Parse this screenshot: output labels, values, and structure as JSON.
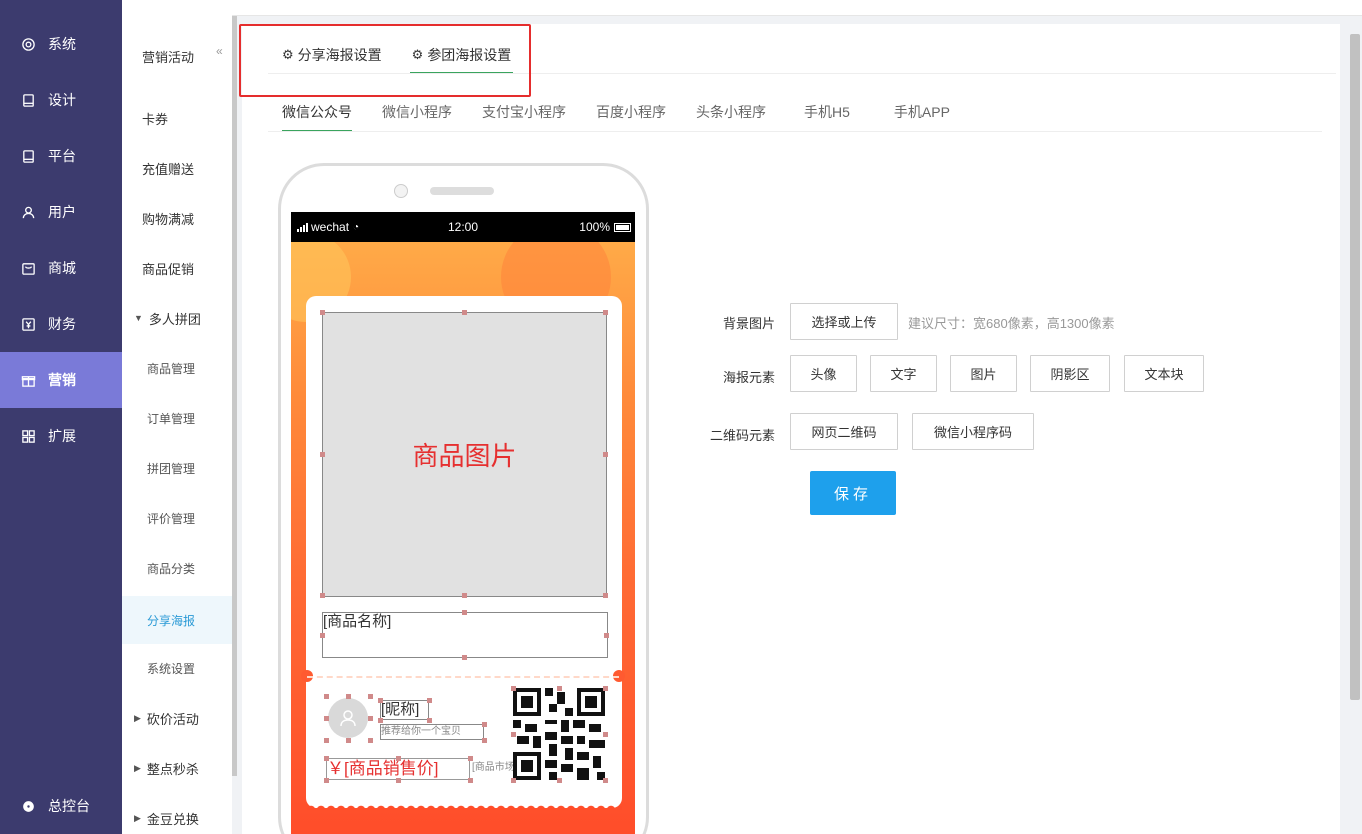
{
  "nav": {
    "items": [
      {
        "label": "系统",
        "icon": "gear-icon"
      },
      {
        "label": "设计",
        "icon": "tablet-icon"
      },
      {
        "label": "平台",
        "icon": "tablet-icon"
      },
      {
        "label": "用户",
        "icon": "user-icon"
      },
      {
        "label": "商城",
        "icon": "shop-icon"
      },
      {
        "label": "财务",
        "icon": "finance-icon"
      },
      {
        "label": "营销",
        "icon": "gift-icon",
        "active": true
      },
      {
        "label": "扩展",
        "icon": "grid-icon"
      }
    ],
    "bottom": {
      "label": "总控台",
      "icon": "gear-icon"
    }
  },
  "subnav": {
    "items": [
      {
        "label": "营销活动"
      },
      {
        "label": "卡券"
      },
      {
        "label": "充值赠送"
      },
      {
        "label": "购物满减"
      },
      {
        "label": "商品促销"
      },
      {
        "label": "多人拼团",
        "expanded": true
      },
      {
        "label": "商品管理"
      },
      {
        "label": "订单管理"
      },
      {
        "label": "拼团管理"
      },
      {
        "label": "评价管理"
      },
      {
        "label": "商品分类"
      },
      {
        "label": "分享海报",
        "active": true
      },
      {
        "label": "系统设置"
      },
      {
        "label": "砍价活动"
      },
      {
        "label": "整点秒杀"
      },
      {
        "label": "金豆兑换"
      }
    ],
    "collapse": "«"
  },
  "poster_tabs": [
    {
      "label": "分享海报设置"
    },
    {
      "label": "参团海报设置",
      "active": true
    }
  ],
  "platform_tabs": [
    {
      "label": "微信公众号",
      "active": true
    },
    {
      "label": "微信小程序"
    },
    {
      "label": "支付宝小程序"
    },
    {
      "label": "百度小程序"
    },
    {
      "label": "头条小程序"
    },
    {
      "label": "手机H5"
    },
    {
      "label": "手机APP"
    }
  ],
  "phone": {
    "status": {
      "carrier": "wechat",
      "time": "12:00",
      "battery": "100%"
    },
    "poster": {
      "product_image": "商品图片",
      "product_name": "[商品名称]",
      "nickname": "[昵称]",
      "recommend": "推荐给你一个宝贝",
      "price": "￥[商品销售价]",
      "market_price": "[商品市场价]"
    }
  },
  "form": {
    "bg_label": "背景图片",
    "bg_button": "选择或上传",
    "bg_hint": "建议尺寸：宽680像素，高1300像素",
    "elements_label": "海报元素",
    "elements": [
      "头像",
      "文字",
      "图片",
      "阴影区",
      "文本块"
    ],
    "qr_label": "二维码元素",
    "qr_elements": [
      "网页二维码",
      "微信小程序码"
    ],
    "save": "保存"
  },
  "colors": {
    "nav_bg": "#3c3b6e",
    "nav_active": "#7a7ad8",
    "accent_green": "#3aa45e",
    "save_blue": "#1ea0ec",
    "highlight_red": "#e52d2d"
  }
}
